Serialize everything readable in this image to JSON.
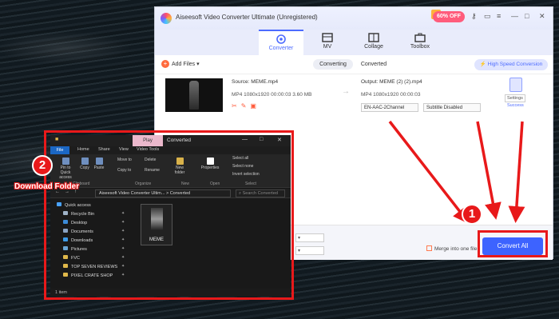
{
  "app": {
    "title": "Aiseesoft Video Converter Ultimate (Unregistered)",
    "promo": "60% OFF",
    "nav_tabs": [
      {
        "label": "Converter",
        "icon": "converter-icon",
        "active": true
      },
      {
        "label": "MV",
        "icon": "mv-icon"
      },
      {
        "label": "Collage",
        "icon": "collage-icon"
      },
      {
        "label": "Toolbox",
        "icon": "toolbox-icon"
      }
    ],
    "toolbar": {
      "add_files": "Add Files",
      "tab_converting": "Converting",
      "tab_converted": "Converted",
      "high_speed": "High Speed Conversion"
    },
    "file": {
      "source": "Source: MEME.mp4",
      "meta": "MP4   1080x1920   00:00:03   3.60 MB",
      "output": "Output: MEME (2) (2).mp4",
      "output_meta": "MP4    1080x1920    00:00:03",
      "audio": "EN-AAC-2Channel",
      "subtitle": "Subtitle Disabled",
      "settings": "Settings",
      "status": "Success"
    },
    "bottom": {
      "merge": "Merge into one file",
      "convert_all": "Convert All"
    }
  },
  "explorer": {
    "play_tab": "Play",
    "caption": "Converted",
    "ribbon_tabs": [
      "File",
      "Home",
      "Share",
      "View",
      "Video Tools"
    ],
    "ribbon_buttons": {
      "pin": "Pin to Quick access",
      "copy": "Copy",
      "paste": "Paste",
      "move_to": "Move to",
      "copy_to": "Copy to",
      "delete": "Delete",
      "rename": "Rename",
      "new_folder": "New folder",
      "properties": "Properties",
      "select_all": "Select all",
      "select_none": "Select none",
      "invert": "Invert selection"
    },
    "groups": [
      "Clipboard",
      "Organize",
      "New",
      "Open",
      "Select"
    ],
    "path": "Aiseesoft Video Converter Ultim...  >  Converted",
    "search": "Search Converted",
    "nav": [
      "Quick access",
      "Recycle Bin",
      "Desktop",
      "Documents",
      "Downloads",
      "Pictures",
      "FVC",
      "TOP SEVEN REVIEWS",
      "PIXEL CRATE SHOP"
    ],
    "file_name": "MEME",
    "status": "1 item"
  },
  "annotations": {
    "badge1": "1",
    "badge2": "2",
    "download_label": "Download Folder",
    "color": "#e8191a"
  }
}
